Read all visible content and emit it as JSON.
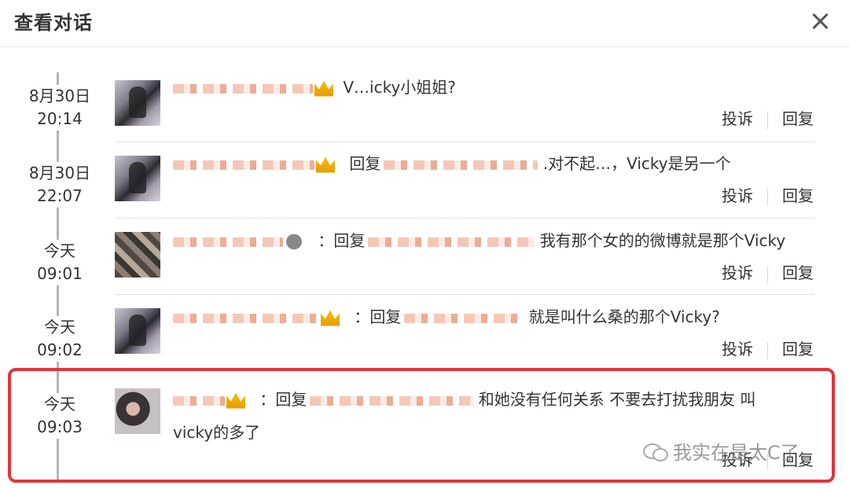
{
  "dialog": {
    "title": "查看对话"
  },
  "entries": [
    {
      "date": "8月30日",
      "time": "20:14",
      "prefix": "",
      "text": "V…icky小姐姐?"
    },
    {
      "date": "8月30日",
      "time": "22:07",
      "prefix": "回复",
      "text": ".对不起…，Vicky是另一个"
    },
    {
      "date": "今天",
      "time": "09:01",
      "prefix": "：回复",
      "text": "我有那个女的的微博就是那个Vicky"
    },
    {
      "date": "今天",
      "time": "09:02",
      "prefix": "：回复",
      "text": "就是叫什么桑的那个Vicky?"
    },
    {
      "date": "今天",
      "time": "09:03",
      "prefix": "：回复",
      "text": "和她没有任何关系 不要去打扰我朋友 叫",
      "text2": "vicky的多了"
    }
  ],
  "actions": {
    "report": "投诉",
    "reply": "回复"
  },
  "watermark": {
    "text": "我实在是太C了"
  }
}
